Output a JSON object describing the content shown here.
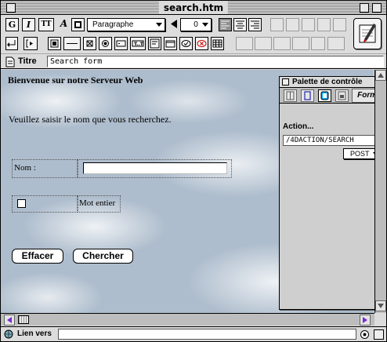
{
  "window": {
    "title": "search.htm"
  },
  "toolbar": {
    "bold_label": "G",
    "italic_label": "I",
    "teletype_label": "TT",
    "font_label": "A",
    "paragraph_style": "Paragraphe",
    "font_size": "0"
  },
  "titre": {
    "label": "Titre",
    "value": "Search form"
  },
  "content": {
    "heading": "Bienvenue sur notre Serveur Web",
    "prompt": "Veuillez saisir le nom que vous recherchez.",
    "nom_label": "Nom :",
    "mot_entier_label": "Mot entier",
    "reset_label": "Effacer",
    "submit_label": "Chercher"
  },
  "palette": {
    "title": "Palette de contrôle",
    "form_tab_label": "Form.",
    "action_label": "Action...",
    "action_value": "/4DACTION/SEARCH",
    "method_value": "POST"
  },
  "status": {
    "label": "Lien vers"
  }
}
